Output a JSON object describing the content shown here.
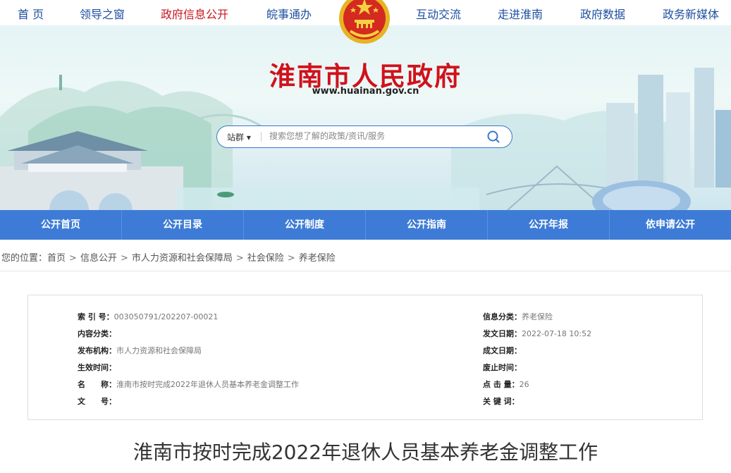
{
  "top_nav": [
    {
      "label": "首 页"
    },
    {
      "label": "领导之窗"
    },
    {
      "label": "政府信息公开"
    },
    {
      "label": "皖事通办"
    },
    {
      "label": "互动交流"
    },
    {
      "label": "走进淮南"
    },
    {
      "label": "政府数据"
    },
    {
      "label": "政务新媒体"
    }
  ],
  "header": {
    "site_title": "淮南市人民政府",
    "site_url": "www.huainan.gov.cn"
  },
  "search": {
    "scope": "站群",
    "placeholder": "搜索您想了解的政策/资讯/服务"
  },
  "section_nav": [
    {
      "label": "公开首页"
    },
    {
      "label": "公开目录"
    },
    {
      "label": "公开制度"
    },
    {
      "label": "公开指南"
    },
    {
      "label": "公开年报"
    },
    {
      "label": "依申请公开"
    }
  ],
  "breadcrumb": {
    "prefix": "您的位置：",
    "items": [
      "首页",
      "信息公开",
      "市人力资源和社会保障局",
      "社会保险",
      "养老保险"
    ],
    "separator": ">"
  },
  "meta": {
    "left": [
      {
        "key": "索 引 号：",
        "value": "003050791/202207-00021"
      },
      {
        "key": "内容分类：",
        "value": ""
      },
      {
        "key": "发布机构：",
        "value": "市人力资源和社会保障局"
      },
      {
        "key": "生效时间：",
        "value": ""
      },
      {
        "key": "名　　称：",
        "value": "淮南市按时完成2022年退休人员基本养老金调整工作"
      },
      {
        "key": "文　　号：",
        "value": ""
      }
    ],
    "right": [
      {
        "key": "信息分类：",
        "value": "养老保险"
      },
      {
        "key": "发文日期：",
        "value": "2022-07-18 10:52"
      },
      {
        "key": "成文日期：",
        "value": ""
      },
      {
        "key": "废止时间：",
        "value": ""
      },
      {
        "key": "点 击 量：",
        "value": "26"
      },
      {
        "key": "关 键 词：",
        "value": ""
      }
    ]
  },
  "article": {
    "title": "淮南市按时完成2022年退休人员基本养老金调整工作"
  },
  "colors": {
    "nav_blue": "#1d4fa0",
    "active_red": "#c8161d",
    "section_bar": "#3d7bd6",
    "title_red": "#d0121b"
  }
}
